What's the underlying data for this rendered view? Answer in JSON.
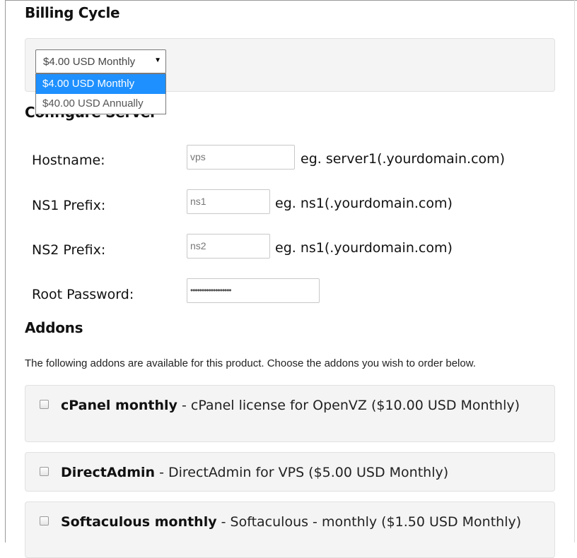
{
  "billing": {
    "title": "Billing Cycle",
    "selected": "$4.00 USD Monthly",
    "options": [
      "$4.00 USD Monthly",
      "$40.00 USD Annually"
    ]
  },
  "configure": {
    "title": "Configure Server",
    "hostname": {
      "label": "Hostname:",
      "value": "vps",
      "hint": "eg. server1(.yourdomain.com)"
    },
    "ns1": {
      "label": "NS1 Prefix:",
      "value": "ns1",
      "hint": "eg. ns1(.yourdomain.com)"
    },
    "ns2": {
      "label": "NS2 Prefix:",
      "value": "ns2",
      "hint": "eg. ns1(.yourdomain.com)"
    },
    "root_password": {
      "label": "Root Password:",
      "value": "••••••••••••••••••"
    }
  },
  "addons": {
    "title": "Addons",
    "description": "The following addons are available for this product. Choose the addons you wish to order below.",
    "items": [
      {
        "name": "cPanel monthly",
        "details": " - cPanel license for OpenVZ ($10.00 USD Monthly)"
      },
      {
        "name": "DirectAdmin",
        "details": " - DirectAdmin for VPS ($5.00 USD Monthly)"
      },
      {
        "name": "Softaculous monthly",
        "details": " - Softaculous - monthly ($1.50 USD Monthly)"
      }
    ]
  }
}
